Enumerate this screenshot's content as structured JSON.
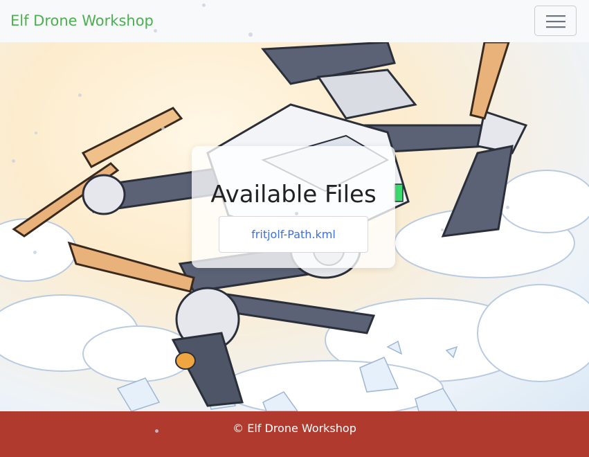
{
  "navbar": {
    "brand": "Elf Drone Workshop",
    "toggler_icon": "hamburger-icon"
  },
  "main": {
    "heading": "Available Files",
    "files": [
      {
        "label": "fritjolf-Path.kml"
      }
    ]
  },
  "hero": {
    "image": "drone-illustration"
  },
  "footer": {
    "text": "© Elf Drone Workshop"
  },
  "colors": {
    "brand": "#4caf50",
    "navbar_bg": "#f8f9fa",
    "footer_bg": "#b03a2e",
    "link": "#3d6fe0"
  }
}
